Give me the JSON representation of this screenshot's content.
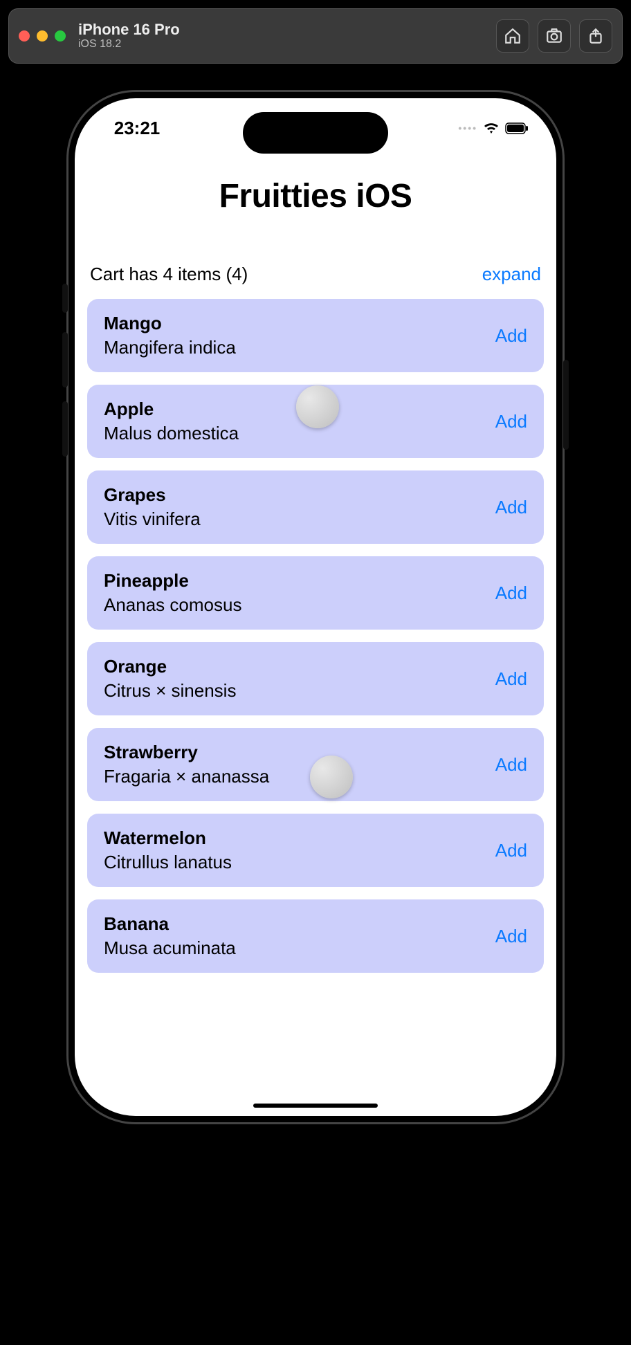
{
  "simulator": {
    "device": "iPhone 16 Pro",
    "os": "iOS 18.2",
    "buttons": {
      "home": "home-icon",
      "screenshot": "screenshot-icon",
      "share": "share-icon"
    }
  },
  "status": {
    "time": "23:21"
  },
  "app": {
    "title": "Fruitties iOS",
    "cart_text": "Cart has 4 items (4)",
    "expand_label": "expand",
    "add_label": "Add",
    "items": [
      {
        "name": "Mango",
        "sci": "Mangifera indica"
      },
      {
        "name": "Apple",
        "sci": "Malus domestica"
      },
      {
        "name": "Grapes",
        "sci": "Vitis vinifera"
      },
      {
        "name": "Pineapple",
        "sci": "Ananas comosus"
      },
      {
        "name": "Orange",
        "sci": "Citrus × sinensis"
      },
      {
        "name": "Strawberry",
        "sci": "Fragaria × ananassa"
      },
      {
        "name": "Watermelon",
        "sci": "Citrullus lanatus"
      },
      {
        "name": "Banana",
        "sci": "Musa acuminata"
      }
    ]
  }
}
